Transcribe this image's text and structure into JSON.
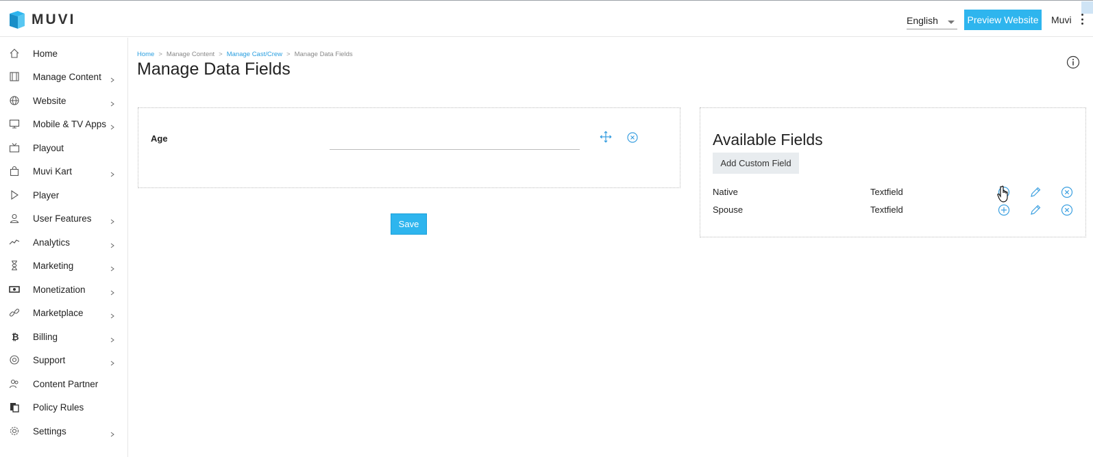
{
  "app": {
    "logo_text": "MUVI"
  },
  "header": {
    "language": "English",
    "preview_button": "Preview Website",
    "user_name": "Muvi"
  },
  "sidebar": {
    "items": [
      {
        "label": "Home",
        "icon": "home-icon",
        "has_children": false
      },
      {
        "label": "Manage Content",
        "icon": "film-icon",
        "has_children": true
      },
      {
        "label": "Website",
        "icon": "globe-icon",
        "has_children": true
      },
      {
        "label": "Mobile & TV Apps",
        "icon": "monitor-icon",
        "has_children": true
      },
      {
        "label": "Playout",
        "icon": "tv-icon",
        "has_children": false
      },
      {
        "label": "Muvi Kart",
        "icon": "shopping-bag-icon",
        "has_children": true
      },
      {
        "label": "Player",
        "icon": "play-icon",
        "has_children": false
      },
      {
        "label": "User Features",
        "icon": "user-icon",
        "has_children": true
      },
      {
        "label": "Analytics",
        "icon": "analytics-icon",
        "has_children": true
      },
      {
        "label": "Marketing",
        "icon": "hourglass-icon",
        "has_children": true
      },
      {
        "label": "Monetization",
        "icon": "money-icon",
        "has_children": true
      },
      {
        "label": "Marketplace",
        "icon": "link-icon",
        "has_children": true
      },
      {
        "label": "Billing",
        "icon": "bitcoin-icon",
        "has_children": true
      },
      {
        "label": "Support",
        "icon": "lifebuoy-icon",
        "has_children": true
      },
      {
        "label": "Content Partner",
        "icon": "partner-icon",
        "has_children": false
      },
      {
        "label": "Policy Rules",
        "icon": "policy-icon",
        "has_children": false
      },
      {
        "label": "Settings",
        "icon": "gear-icon",
        "has_children": true
      }
    ]
  },
  "breadcrumb": {
    "items": [
      "Home",
      "Manage Content",
      "Manage Cast/Crew",
      "Manage Data Fields"
    ],
    "separator": ">"
  },
  "page": {
    "title": "Manage Data Fields"
  },
  "form": {
    "field_label": "Age",
    "field_value": "",
    "save_label": "Save"
  },
  "available": {
    "title": "Available Fields",
    "add_button": "Add Custom Field",
    "rows": [
      {
        "name": "Native",
        "type": "Textfield"
      },
      {
        "name": "Spouse",
        "type": "Textfield"
      }
    ]
  },
  "colors": {
    "accent": "#2eb5ee",
    "link": "#2a9fe0",
    "icon_blue": "#3a9fe0"
  }
}
